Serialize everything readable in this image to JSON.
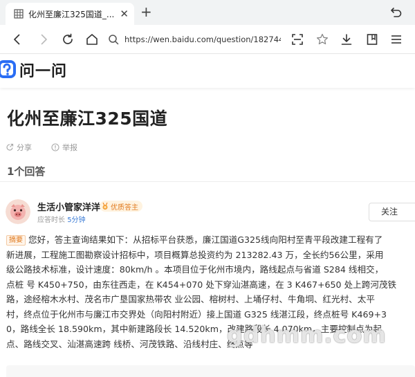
{
  "browser": {
    "tab": {
      "title": "化州至廉江325国道_..."
    },
    "address": {
      "url": "https://wen.baidu.com/question/182744..."
    }
  },
  "site": {
    "logo_text": "问一问"
  },
  "question": {
    "title": "化州至廉江325国道",
    "share_label": "分享",
    "report_label": "举报",
    "answer_count": "1个回答"
  },
  "answer": {
    "author_name": "生活小管家洋洋",
    "badge_label": "优质答主",
    "meta_prefix": "应答时长",
    "meta_value": "5分钟",
    "follow_label": "关注",
    "tag_label": "摘要",
    "lines": [
      "您好，答主查询结果如下：从招标平台获悉，廉江国道G325线向阳村至青平段改建工程有了",
      "新进展，工程施工图勘察设计招标中，项目概算总投资约为 213282.43 万，全长约56公里，采用",
      "级公路技术标准，设计速度：80km/h 。本项目位于化州市境内，路线起点与省道 S284 线相交，",
      "点桩 号 K450+750，由东往西走，在 K454+070 处下穿汕湛高速，在 3 K467+650 处上跨河茂铁",
      "路，途经榕木水村、茂名市广垦国家热带农 业公园、榕树村、上埇仔村、牛角垌、红光村、太平",
      "村，终点位于化州市与廉江市交界处（向阳村附近）接上国道 G325 线湛江段，终点桩号 K469+3",
      "0，路线全长 18.590km，其中新建路段长 14.520km，改建路段长 4.070km，主要控制点为起",
      "点、路线交叉、汕湛高速跨 线桥、河茂铁路、沿线村庄、终点等"
    ]
  },
  "watermark": {
    "text": "gdhmm.com"
  }
}
